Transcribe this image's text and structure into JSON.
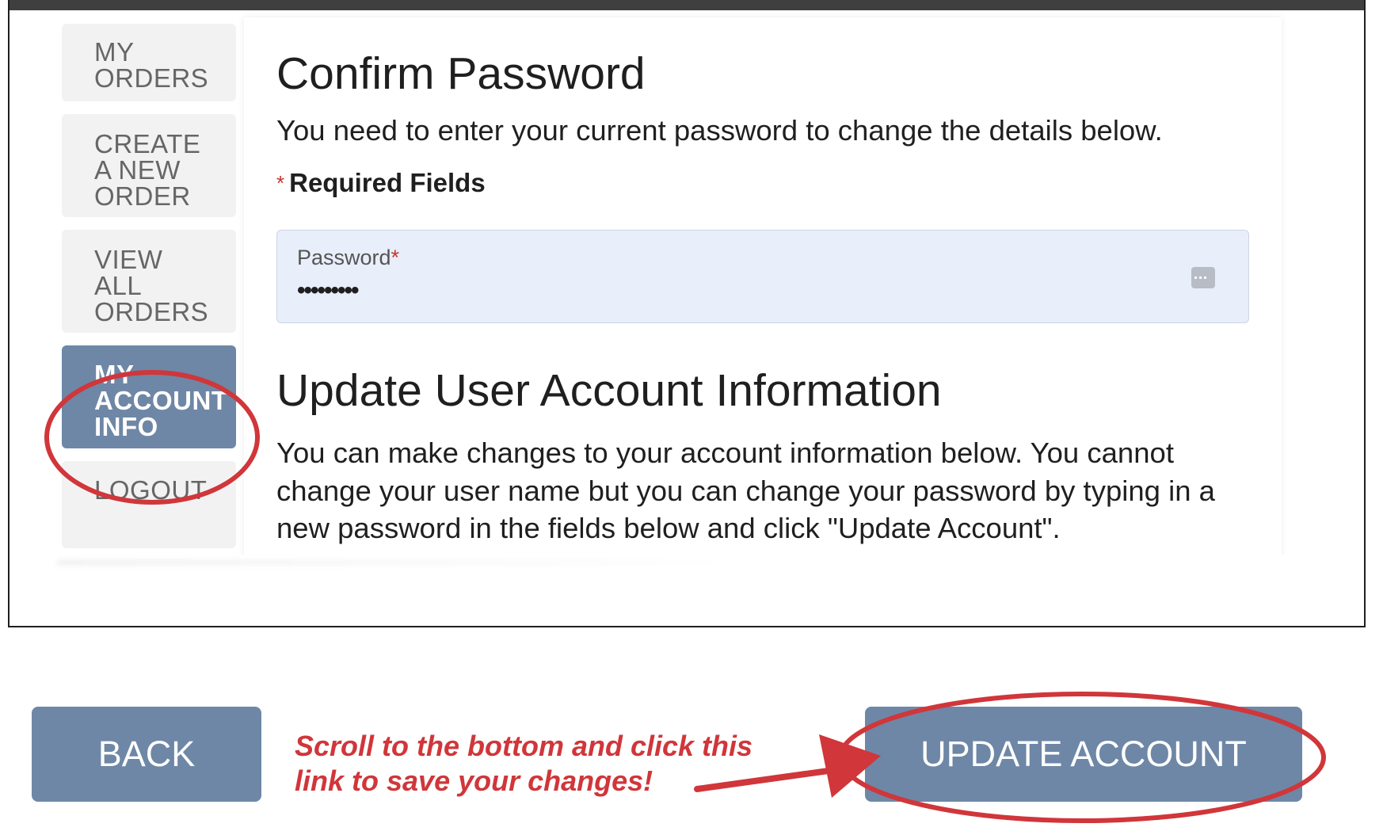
{
  "nav": {
    "items": [
      {
        "lines": [
          "MY",
          "ORDERS"
        ],
        "active": false
      },
      {
        "lines": [
          "CREATE",
          "A NEW",
          "ORDER"
        ],
        "active": false
      },
      {
        "lines": [
          "VIEW",
          "ALL",
          "ORDERS"
        ],
        "active": false
      },
      {
        "lines": [
          "MY",
          "ACCOUNT",
          "INFO"
        ],
        "active": true
      },
      {
        "lines": [
          "LOGOUT"
        ],
        "active": false
      }
    ]
  },
  "confirm": {
    "title": "Confirm Password",
    "description": "You need to enter your current password to change the details below.",
    "required_star": "*",
    "required_text": "Required Fields",
    "password_label": "Password",
    "password_star": "*",
    "password_value": "•••••••••",
    "password_icon": "password-manager-icon"
  },
  "update": {
    "title": "Update User Account Information",
    "description": "You can make changes to your account information below. You cannot change your user name but you can change your password by typing in a new password in the fields below and click \"Update Account\"."
  },
  "buttons": {
    "back": "BACK",
    "update": "UPDATE ACCOUNT"
  },
  "annotation": {
    "line1": "Scroll to the bottom and click this",
    "line2": "link to save your changes!",
    "color": "#d0363a"
  },
  "colors": {
    "accent": "#6e87a6",
    "nav_bg": "#f2f2f2",
    "field_bg": "#e8eefa",
    "annotation_red": "#d0363a"
  }
}
